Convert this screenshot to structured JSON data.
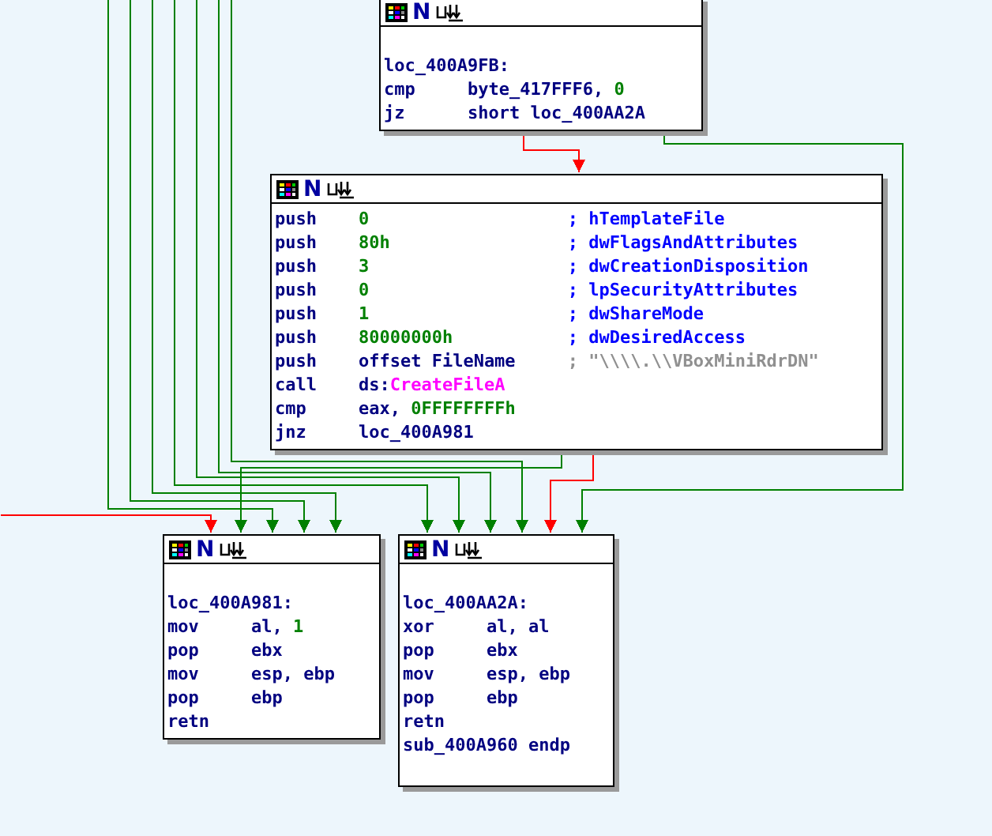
{
  "edges": [
    {
      "color": "#ff0000"
    },
    {
      "color": "#008000"
    },
    {
      "color": "#008000"
    },
    {
      "color": "#ff0000"
    },
    {
      "color": "#ff0000"
    },
    {
      "color": "#008000"
    },
    {
      "color": "#008000"
    },
    {
      "color": "#008000"
    },
    {
      "color": "#008000"
    },
    {
      "color": "#008000"
    },
    {
      "color": "#008000"
    },
    {
      "color": "#008000"
    }
  ],
  "nodes": [
    {
      "tag": "N",
      "rows": [
        {
          "kind": "blank"
        },
        {
          "kind": "label",
          "text": "loc_400A9FB:"
        },
        {
          "kind": "instr",
          "op": "cmp",
          "args": [
            {
              "text": "byte_417FFF6, ",
              "kind": "name"
            },
            {
              "text": "0",
              "kind": "num"
            }
          ]
        },
        {
          "kind": "instr",
          "op": "jz",
          "args": [
            {
              "text": "short loc_400AA2A",
              "kind": "name"
            }
          ]
        }
      ]
    },
    {
      "tag": "N",
      "rows": [
        {
          "kind": "instr",
          "op": "push",
          "args": [
            {
              "text": "0",
              "kind": "num"
            }
          ],
          "comment": {
            "text": "; hTemplateFile",
            "kind": "comment"
          }
        },
        {
          "kind": "instr",
          "op": "push",
          "args": [
            {
              "text": "80h",
              "kind": "num"
            }
          ],
          "comment": {
            "text": "; dwFlagsAndAttributes",
            "kind": "comment"
          }
        },
        {
          "kind": "instr",
          "op": "push",
          "args": [
            {
              "text": "3",
              "kind": "num"
            }
          ],
          "comment": {
            "text": "; dwCreationDisposition",
            "kind": "comment"
          }
        },
        {
          "kind": "instr",
          "op": "push",
          "args": [
            {
              "text": "0",
              "kind": "num"
            }
          ],
          "comment": {
            "text": "; lpSecurityAttributes",
            "kind": "comment"
          }
        },
        {
          "kind": "instr",
          "op": "push",
          "args": [
            {
              "text": "1",
              "kind": "num"
            }
          ],
          "comment": {
            "text": "; dwShareMode",
            "kind": "comment"
          }
        },
        {
          "kind": "instr",
          "op": "push",
          "args": [
            {
              "text": "80000000h",
              "kind": "num"
            }
          ],
          "comment": {
            "text": "; dwDesiredAccess",
            "kind": "comment"
          }
        },
        {
          "kind": "instr",
          "op": "push",
          "args": [
            {
              "text": "offset FileName",
              "kind": "name"
            }
          ],
          "comment": {
            "text": "; \"\\\\\\\\.\\\\VBoxMiniRdrDN\"",
            "kind": "string"
          }
        },
        {
          "kind": "instr",
          "op": "call",
          "args": [
            {
              "text": "ds:",
              "kind": "name"
            },
            {
              "text": "CreateFileA",
              "kind": "import"
            }
          ]
        },
        {
          "kind": "instr",
          "op": "cmp",
          "args": [
            {
              "text": "eax, ",
              "kind": "name"
            },
            {
              "text": "0FFFFFFFFh",
              "kind": "num"
            }
          ]
        },
        {
          "kind": "instr",
          "op": "jnz",
          "args": [
            {
              "text": "loc_400A981",
              "kind": "name"
            }
          ]
        }
      ]
    },
    {
      "tag": "N",
      "rows": [
        {
          "kind": "blank"
        },
        {
          "kind": "label",
          "text": "loc_400A981:"
        },
        {
          "kind": "instr",
          "op": "mov",
          "args": [
            {
              "text": "al, ",
              "kind": "name"
            },
            {
              "text": "1",
              "kind": "num"
            }
          ]
        },
        {
          "kind": "instr",
          "op": "pop",
          "args": [
            {
              "text": "ebx",
              "kind": "name"
            }
          ]
        },
        {
          "kind": "instr",
          "op": "mov",
          "args": [
            {
              "text": "esp, ebp",
              "kind": "name"
            }
          ]
        },
        {
          "kind": "instr",
          "op": "pop",
          "args": [
            {
              "text": "ebp",
              "kind": "name"
            }
          ]
        },
        {
          "kind": "instr",
          "op": "retn"
        }
      ]
    },
    {
      "tag": "N",
      "rows": [
        {
          "kind": "blank"
        },
        {
          "kind": "label",
          "text": "loc_400AA2A:"
        },
        {
          "kind": "instr",
          "op": "xor",
          "args": [
            {
              "text": "al, al",
              "kind": "name"
            }
          ]
        },
        {
          "kind": "instr",
          "op": "pop",
          "args": [
            {
              "text": "ebx",
              "kind": "name"
            }
          ]
        },
        {
          "kind": "instr",
          "op": "mov",
          "args": [
            {
              "text": "esp, ebp",
              "kind": "name"
            }
          ]
        },
        {
          "kind": "instr",
          "op": "pop",
          "args": [
            {
              "text": "ebp",
              "kind": "name"
            }
          ]
        },
        {
          "kind": "instr",
          "op": "retn"
        },
        {
          "kind": "endp",
          "text": "sub_400A960 endp"
        },
        {
          "kind": "blank"
        }
      ]
    }
  ]
}
